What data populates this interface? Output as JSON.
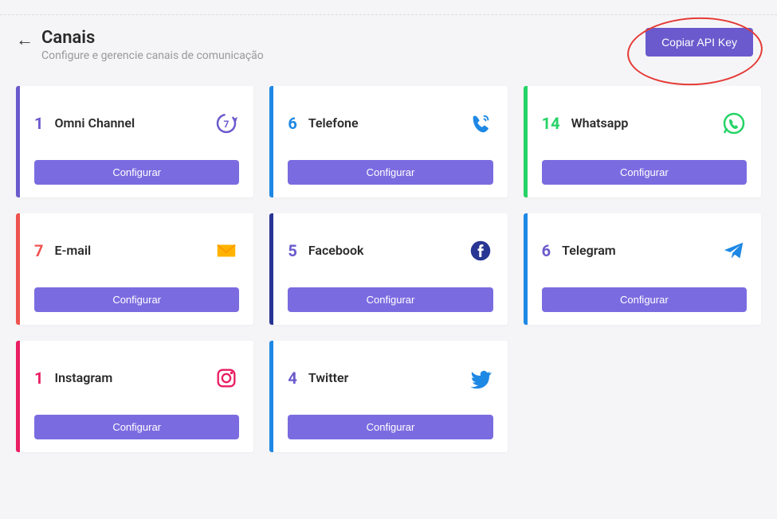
{
  "header": {
    "title": "Canais",
    "subtitle": "Configure e gerencie canais de comunicação",
    "api_key_btn": "Copiar API Key"
  },
  "config_label": "Configurar",
  "channels": [
    {
      "count": "1",
      "name": "Omni Channel",
      "stripe": "#6a5acd",
      "count_color": "#6a5acd",
      "icon": "omni"
    },
    {
      "count": "6",
      "name": "Telefone",
      "stripe": "#1e88e5",
      "count_color": "#1e88e5",
      "icon": "phone"
    },
    {
      "count": "14",
      "name": "Whatsapp",
      "stripe": "#25d366",
      "count_color": "#25d366",
      "icon": "whatsapp"
    },
    {
      "count": "7",
      "name": "E-mail",
      "stripe": "#ef5350",
      "count_color": "#ef5350",
      "icon": "email"
    },
    {
      "count": "5",
      "name": "Facebook",
      "stripe": "#283593",
      "count_color": "#6a5acd",
      "icon": "facebook"
    },
    {
      "count": "6",
      "name": "Telegram",
      "stripe": "#1e88e5",
      "count_color": "#6a5acd",
      "icon": "telegram"
    },
    {
      "count": "1",
      "name": "Instagram",
      "stripe": "#e91e63",
      "count_color": "#e91e63",
      "icon": "instagram"
    },
    {
      "count": "4",
      "name": "Twitter",
      "stripe": "#1e88e5",
      "count_color": "#6a5acd",
      "icon": "twitter"
    }
  ]
}
